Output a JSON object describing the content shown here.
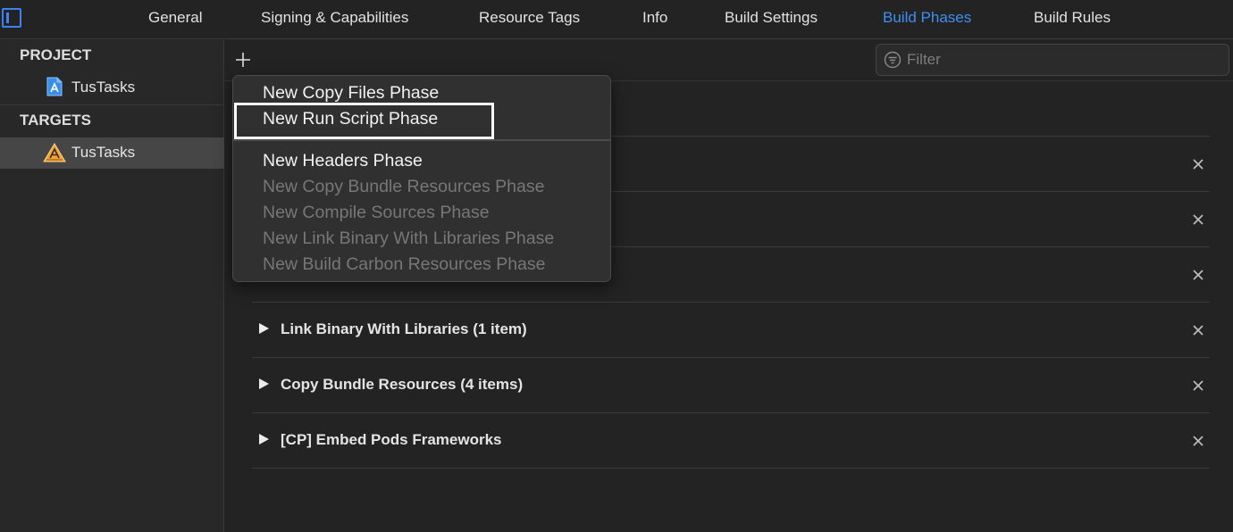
{
  "tabs": [
    {
      "label": "General"
    },
    {
      "label": "Signing & Capabilities"
    },
    {
      "label": "Resource Tags"
    },
    {
      "label": "Info"
    },
    {
      "label": "Build Settings"
    },
    {
      "label": "Build Phases",
      "active": true
    },
    {
      "label": "Build Rules"
    }
  ],
  "sidebar": {
    "project_header": "PROJECT",
    "project_name": "TusTasks",
    "targets_header": "TARGETS",
    "target_name": "TusTasks"
  },
  "filter": {
    "placeholder": "Filter",
    "value": ""
  },
  "add_menu": {
    "items": [
      {
        "label": "New Copy Files Phase",
        "enabled": true
      },
      {
        "label": "New Run Script Phase",
        "enabled": true,
        "highlighted": true
      },
      {
        "label": "New Headers Phase",
        "enabled": true
      },
      {
        "label": "New Copy Bundle Resources Phase",
        "enabled": false
      },
      {
        "label": "New Compile Sources Phase",
        "enabled": false
      },
      {
        "label": "New Link Binary With Libraries Phase",
        "enabled": false
      },
      {
        "label": "New Build Carbon Resources Phase",
        "enabled": false
      }
    ]
  },
  "phases": [
    {
      "title": "Link Binary With Libraries (1 item)"
    },
    {
      "title": "Copy Bundle Resources (4 items)"
    },
    {
      "title": "[CP] Embed Pods Frameworks"
    }
  ],
  "colors": {
    "accent": "#3d8ff5",
    "background": "#232323",
    "sidebar": "#282828",
    "selection": "#464646",
    "menu": "#303030"
  }
}
